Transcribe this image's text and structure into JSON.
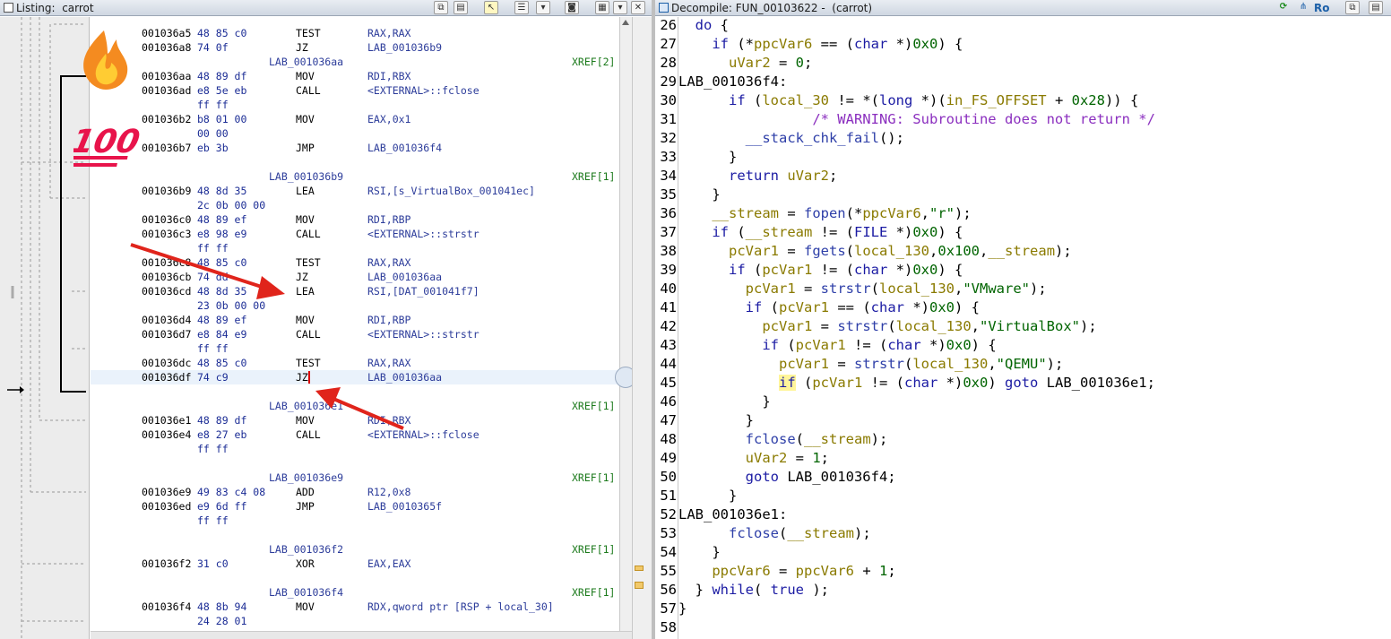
{
  "listing": {
    "title": "Listing:  carrot",
    "lines": [
      {
        "addr": "001036a5",
        "bytes": "48 85 c0",
        "mn": "TEST",
        "op": "RAX,RAX"
      },
      {
        "addr": "001036a8",
        "bytes": "74 0f",
        "mn": "JZ",
        "op": "LAB_001036b9"
      },
      {
        "label": "LAB_001036aa",
        "xref": "XREF[2]"
      },
      {
        "addr": "001036aa",
        "bytes": "48 89 df",
        "mn": "MOV",
        "op": "RDI,RBX"
      },
      {
        "addr": "001036ad",
        "bytes": "e8 5e eb",
        "mn": "CALL",
        "op": "<EXTERNAL>::fclose"
      },
      {
        "bytes": "ff ff"
      },
      {
        "addr": "001036b2",
        "bytes": "b8 01 00",
        "mn": "MOV",
        "op": "EAX,0x1"
      },
      {
        "bytes": "00 00"
      },
      {
        "addr": "001036b7",
        "bytes": "eb 3b",
        "mn": "JMP",
        "op": "LAB_001036f4"
      },
      {},
      {
        "label": "LAB_001036b9",
        "xref": "XREF[1]"
      },
      {
        "addr": "001036b9",
        "bytes": "48 8d 35",
        "mn": "LEA",
        "op": "RSI,[s_VirtualBox_001041ec]"
      },
      {
        "bytes": "2c 0b 00 00"
      },
      {
        "addr": "001036c0",
        "bytes": "48 89 ef",
        "mn": "MOV",
        "op": "RDI,RBP"
      },
      {
        "addr": "001036c3",
        "bytes": "e8 98 e9",
        "mn": "CALL",
        "op": "<EXTERNAL>::strstr"
      },
      {
        "bytes": "ff ff"
      },
      {
        "addr": "001036c8",
        "bytes": "48 85 c0",
        "mn": "TEST",
        "op": "RAX,RAX"
      },
      {
        "addr": "001036cb",
        "bytes": "74 dd",
        "mn": "JZ",
        "op": "LAB_001036aa"
      },
      {
        "addr": "001036cd",
        "bytes": "48 8d 35",
        "mn": "LEA",
        "op": "RSI,[DAT_001041f7]"
      },
      {
        "bytes": "23 0b 00 00"
      },
      {
        "addr": "001036d4",
        "bytes": "48 89 ef",
        "mn": "MOV",
        "op": "RDI,RBP"
      },
      {
        "addr": "001036d7",
        "bytes": "e8 84 e9",
        "mn": "CALL",
        "op": "<EXTERNAL>::strstr"
      },
      {
        "bytes": "ff ff"
      },
      {
        "addr": "001036dc",
        "bytes": "48 85 c0",
        "mn": "TEST",
        "op": "RAX,RAX"
      },
      {
        "addr": "001036df",
        "bytes": "74 c9",
        "mn": "JZ",
        "op": "LAB_001036aa",
        "hl": true
      },
      {},
      {
        "label": "LAB_001036e1",
        "xref": "XREF[1]"
      },
      {
        "addr": "001036e1",
        "bytes": "48 89 df",
        "mn": "MOV",
        "op": "RDI,RBX"
      },
      {
        "addr": "001036e4",
        "bytes": "e8 27 eb",
        "mn": "CALL",
        "op": "<EXTERNAL>::fclose"
      },
      {
        "bytes": "ff ff"
      },
      {},
      {
        "label": "LAB_001036e9",
        "xref": "XREF[1]"
      },
      {
        "addr": "001036e9",
        "bytes": "49 83 c4 08",
        "mn": "ADD",
        "op": "R12,0x8"
      },
      {
        "addr": "001036ed",
        "bytes": "e9 6d ff",
        "mn": "JMP",
        "op": "LAB_0010365f"
      },
      {
        "bytes": "ff ff"
      },
      {},
      {
        "label": "LAB_001036f2",
        "xref": "XREF[1]"
      },
      {
        "addr": "001036f2",
        "bytes": "31 c0",
        "mn": "XOR",
        "op": "EAX,EAX"
      },
      {},
      {
        "label": "LAB_001036f4",
        "xref": "XREF[1]"
      },
      {
        "addr": "001036f4",
        "bytes": "48 8b 94",
        "mn": "MOV",
        "op": "RDX,qword ptr [RSP + local_30]"
      },
      {
        "bytes": "24 28 01"
      }
    ]
  },
  "decompile": {
    "title": "Decompile: FUN_00103622 -  (carrot)",
    "ro_label": "Ro",
    "lines": [
      {
        "n": "26",
        "seg": [
          [
            "  ",
            ""
          ],
          [
            "do",
            "kw"
          ],
          [
            " {",
            ""
          ]
        ]
      },
      {
        "n": "27",
        "seg": [
          [
            "    ",
            ""
          ],
          [
            "if",
            "kw"
          ],
          [
            " (*",
            ""
          ],
          [
            "ppcVar6",
            "vr"
          ],
          [
            " == (",
            ""
          ],
          [
            "char",
            "kw"
          ],
          [
            " *)",
            ""
          ],
          [
            "0x0",
            "nm"
          ],
          [
            ") {",
            ""
          ]
        ]
      },
      {
        "n": "28",
        "seg": [
          [
            "      ",
            ""
          ],
          [
            "uVar2",
            "vr"
          ],
          [
            " = ",
            ""
          ],
          [
            "0",
            "nm"
          ],
          [
            ";",
            ""
          ]
        ]
      },
      {
        "n": "29",
        "seg": [
          [
            "LAB_001036f4:",
            ""
          ]
        ]
      },
      {
        "n": "30",
        "seg": [
          [
            "      ",
            ""
          ],
          [
            "if",
            "kw"
          ],
          [
            " (",
            ""
          ],
          [
            "local_30",
            "vr"
          ],
          [
            " != *(",
            ""
          ],
          [
            "long",
            "kw"
          ],
          [
            " *)(",
            ""
          ],
          [
            "in_FS_OFFSET",
            "vr"
          ],
          [
            " + ",
            ""
          ],
          [
            "0x28",
            "nm"
          ],
          [
            ")) {",
            ""
          ]
        ]
      },
      {
        "n": "31",
        "seg": [
          [
            "                ",
            ""
          ],
          [
            "/* WARNING: Subroutine does not return */",
            "cm"
          ]
        ]
      },
      {
        "n": "32",
        "seg": [
          [
            "        ",
            ""
          ],
          [
            "__stack_chk_fail",
            "fn"
          ],
          [
            "();",
            ""
          ]
        ]
      },
      {
        "n": "33",
        "seg": [
          [
            "      }",
            ""
          ]
        ]
      },
      {
        "n": "34",
        "seg": [
          [
            "      ",
            ""
          ],
          [
            "return",
            "kw"
          ],
          [
            " ",
            ""
          ],
          [
            "uVar2",
            "vr"
          ],
          [
            ";",
            ""
          ]
        ]
      },
      {
        "n": "35",
        "seg": [
          [
            "    }",
            ""
          ]
        ]
      },
      {
        "n": "36",
        "seg": [
          [
            "    ",
            ""
          ],
          [
            "__stream",
            "vr"
          ],
          [
            " = ",
            ""
          ],
          [
            "fopen",
            "fn"
          ],
          [
            "(*",
            ""
          ],
          [
            "ppcVar6",
            "vr"
          ],
          [
            ",",
            ""
          ],
          [
            "\"r\"",
            "st"
          ],
          [
            ");",
            ""
          ]
        ]
      },
      {
        "n": "37",
        "seg": [
          [
            "    ",
            ""
          ],
          [
            "if",
            "kw"
          ],
          [
            " (",
            ""
          ],
          [
            "__stream",
            "vr"
          ],
          [
            " != (",
            ""
          ],
          [
            "FILE",
            "kw"
          ],
          [
            " *)",
            ""
          ],
          [
            "0x0",
            "nm"
          ],
          [
            ") {",
            ""
          ]
        ]
      },
      {
        "n": "38",
        "seg": [
          [
            "      ",
            ""
          ],
          [
            "pcVar1",
            "vr"
          ],
          [
            " = ",
            ""
          ],
          [
            "fgets",
            "fn"
          ],
          [
            "(",
            ""
          ],
          [
            "local_130",
            "vr"
          ],
          [
            ",",
            ""
          ],
          [
            "0x100",
            "nm"
          ],
          [
            ",",
            ""
          ],
          [
            "__stream",
            "vr"
          ],
          [
            ");",
            ""
          ]
        ]
      },
      {
        "n": "39",
        "seg": [
          [
            "      ",
            ""
          ],
          [
            "if",
            "kw"
          ],
          [
            " (",
            ""
          ],
          [
            "pcVar1",
            "vr"
          ],
          [
            " != (",
            ""
          ],
          [
            "char",
            "kw"
          ],
          [
            " *)",
            ""
          ],
          [
            "0x0",
            "nm"
          ],
          [
            ") {",
            ""
          ]
        ]
      },
      {
        "n": "40",
        "seg": [
          [
            "        ",
            ""
          ],
          [
            "pcVar1",
            "vr"
          ],
          [
            " = ",
            ""
          ],
          [
            "strstr",
            "fn"
          ],
          [
            "(",
            ""
          ],
          [
            "local_130",
            "vr"
          ],
          [
            ",",
            ""
          ],
          [
            "\"VMware\"",
            "st"
          ],
          [
            ");",
            ""
          ]
        ]
      },
      {
        "n": "41",
        "seg": [
          [
            "        ",
            ""
          ],
          [
            "if",
            "kw"
          ],
          [
            " (",
            ""
          ],
          [
            "pcVar1",
            "vr"
          ],
          [
            " == (",
            ""
          ],
          [
            "char",
            "kw"
          ],
          [
            " *)",
            ""
          ],
          [
            "0x0",
            "nm"
          ],
          [
            ") {",
            ""
          ]
        ]
      },
      {
        "n": "42",
        "seg": [
          [
            "          ",
            ""
          ],
          [
            "pcVar1",
            "vr"
          ],
          [
            " = ",
            ""
          ],
          [
            "strstr",
            "fn"
          ],
          [
            "(",
            ""
          ],
          [
            "local_130",
            "vr"
          ],
          [
            ",",
            ""
          ],
          [
            "\"VirtualBox\"",
            "st"
          ],
          [
            ");",
            ""
          ]
        ]
      },
      {
        "n": "43",
        "seg": [
          [
            "          ",
            ""
          ],
          [
            "if",
            "kw"
          ],
          [
            " (",
            ""
          ],
          [
            "pcVar1",
            "vr"
          ],
          [
            " != (",
            ""
          ],
          [
            "char",
            "kw"
          ],
          [
            " *)",
            ""
          ],
          [
            "0x0",
            "nm"
          ],
          [
            ") {",
            ""
          ]
        ]
      },
      {
        "n": "44",
        "seg": [
          [
            "            ",
            ""
          ],
          [
            "pcVar1",
            "vr"
          ],
          [
            " = ",
            ""
          ],
          [
            "strstr",
            "fn"
          ],
          [
            "(",
            ""
          ],
          [
            "local_130",
            "vr"
          ],
          [
            ",",
            ""
          ],
          [
            "\"QEMU\"",
            "st"
          ],
          [
            ");",
            ""
          ]
        ]
      },
      {
        "n": "45",
        "seg": [
          [
            "            ",
            ""
          ],
          [
            "if",
            "kwh"
          ],
          [
            " (",
            ""
          ],
          [
            "pcVar1",
            "vr"
          ],
          [
            " != (",
            ""
          ],
          [
            "char",
            "kw"
          ],
          [
            " *)",
            ""
          ],
          [
            "0x0",
            "nm"
          ],
          [
            ") ",
            ""
          ],
          [
            "goto",
            "kw"
          ],
          [
            " LAB_001036e1;",
            ""
          ]
        ]
      },
      {
        "n": "46",
        "seg": [
          [
            "          }",
            ""
          ]
        ]
      },
      {
        "n": "47",
        "seg": [
          [
            "        }",
            ""
          ]
        ]
      },
      {
        "n": "48",
        "seg": [
          [
            "        ",
            ""
          ],
          [
            "fclose",
            "fn"
          ],
          [
            "(",
            ""
          ],
          [
            "__stream",
            "vr"
          ],
          [
            ");",
            ""
          ]
        ]
      },
      {
        "n": "49",
        "seg": [
          [
            "        ",
            ""
          ],
          [
            "uVar2",
            "vr"
          ],
          [
            " = ",
            ""
          ],
          [
            "1",
            "nm"
          ],
          [
            ";",
            ""
          ]
        ]
      },
      {
        "n": "50",
        "seg": [
          [
            "        ",
            ""
          ],
          [
            "goto",
            "kw"
          ],
          [
            " LAB_001036f4;",
            ""
          ]
        ]
      },
      {
        "n": "51",
        "seg": [
          [
            "      }",
            ""
          ]
        ]
      },
      {
        "n": "52",
        "seg": [
          [
            "LAB_001036e1:",
            ""
          ]
        ]
      },
      {
        "n": "53",
        "seg": [
          [
            "      ",
            ""
          ],
          [
            "fclose",
            "fn"
          ],
          [
            "(",
            ""
          ],
          [
            "__stream",
            "vr"
          ],
          [
            ");",
            ""
          ]
        ]
      },
      {
        "n": "54",
        "seg": [
          [
            "    }",
            ""
          ]
        ]
      },
      {
        "n": "55",
        "seg": [
          [
            "    ",
            ""
          ],
          [
            "ppcVar6",
            "vr"
          ],
          [
            " = ",
            ""
          ],
          [
            "ppcVar6",
            "vr"
          ],
          [
            " + ",
            ""
          ],
          [
            "1",
            "nm"
          ],
          [
            ";",
            ""
          ]
        ]
      },
      {
        "n": "56",
        "seg": [
          [
            "  } ",
            ""
          ],
          [
            "while",
            "kw"
          ],
          [
            "( ",
            ""
          ],
          [
            "true",
            "kw"
          ],
          [
            " );",
            ""
          ]
        ]
      },
      {
        "n": "57",
        "seg": [
          [
            "}",
            ""
          ]
        ]
      },
      {
        "n": "58",
        "seg": [
          [
            "",
            ""
          ]
        ]
      }
    ]
  },
  "stickers": {
    "hundred": "100"
  },
  "colors": {
    "arrow": "#e0241b",
    "keyword": "#1b1ba3",
    "variable": "#8a7a00",
    "number": "#006400",
    "comment": "#8b2fbf"
  }
}
